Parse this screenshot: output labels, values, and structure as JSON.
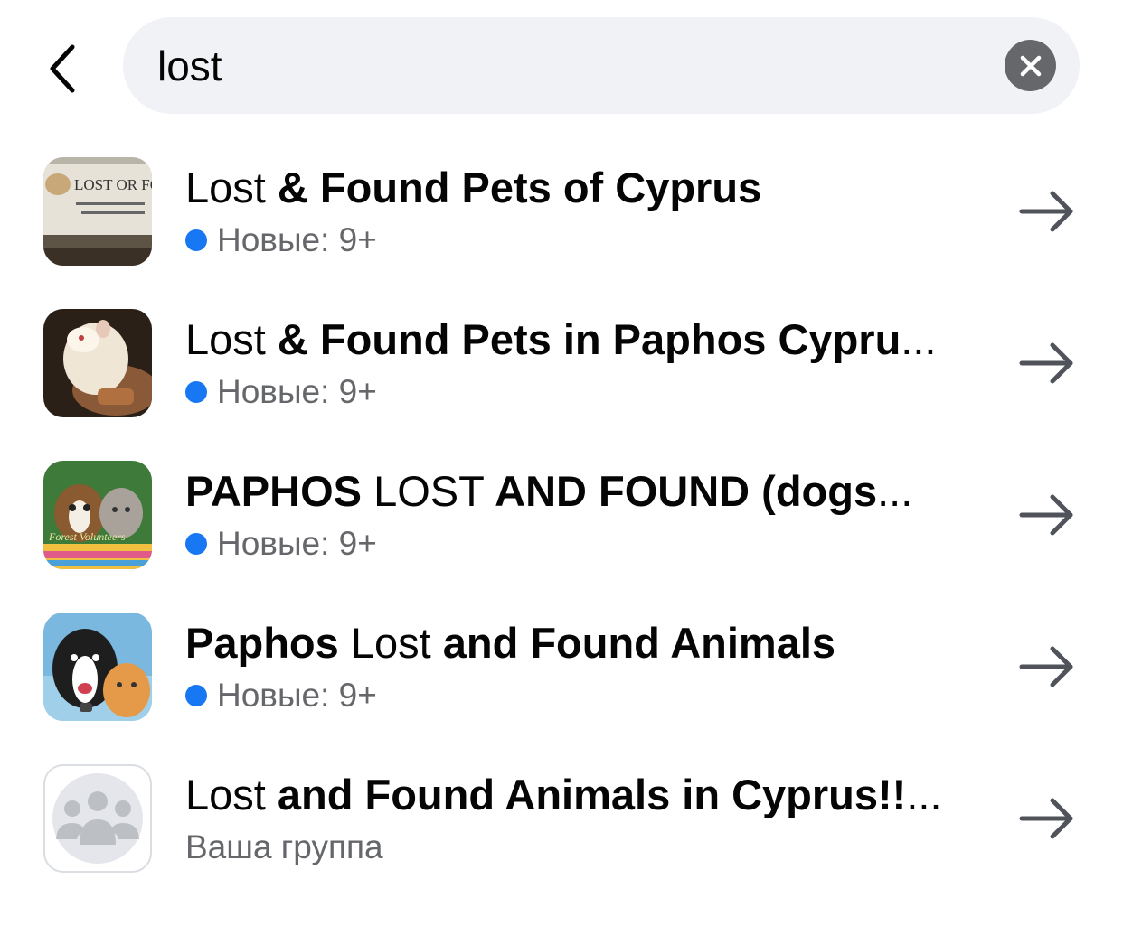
{
  "search": {
    "query": "lost"
  },
  "icons": {
    "back": "chevron-left-icon",
    "clear": "close-circle-icon",
    "open": "arrow-right-icon",
    "group_placeholder": "group-people-icon"
  },
  "colors": {
    "unread_dot": "#1877f2",
    "secondary_text": "#65676b",
    "search_bg": "#f0f2f5"
  },
  "results": [
    {
      "title_parts": [
        {
          "text": "Lost",
          "bold": false
        },
        {
          "text": " & Found Pets of Cyprus",
          "bold": true
        }
      ],
      "subtitle": "Новые: 9+",
      "unread": true,
      "thumbnail_text": "LOST OR FOUND"
    },
    {
      "title_parts": [
        {
          "text": "Lost",
          "bold": false
        },
        {
          "text": " & Found Pets in Paphos Cypru",
          "bold": true
        },
        {
          "text": "...",
          "bold": false
        }
      ],
      "subtitle": "Новые: 9+",
      "unread": true
    },
    {
      "title_parts": [
        {
          "text": "PAPHOS ",
          "bold": true
        },
        {
          "text": "LOST",
          "bold": false
        },
        {
          "text": " AND FOUND (dogs",
          "bold": true
        },
        {
          "text": "...",
          "bold": false
        }
      ],
      "subtitle": "Новые: 9+",
      "unread": true
    },
    {
      "title_parts": [
        {
          "text": "Paphos ",
          "bold": true
        },
        {
          "text": "Lost",
          "bold": false
        },
        {
          "text": " and Found Animals",
          "bold": true
        }
      ],
      "subtitle": "Новые: 9+",
      "unread": true
    },
    {
      "title_parts": [
        {
          "text": "Lost",
          "bold": false
        },
        {
          "text": " and Found Animals in Cyprus!!",
          "bold": true
        },
        {
          "text": "...",
          "bold": false
        }
      ],
      "subtitle": "Ваша группа",
      "unread": false
    }
  ]
}
